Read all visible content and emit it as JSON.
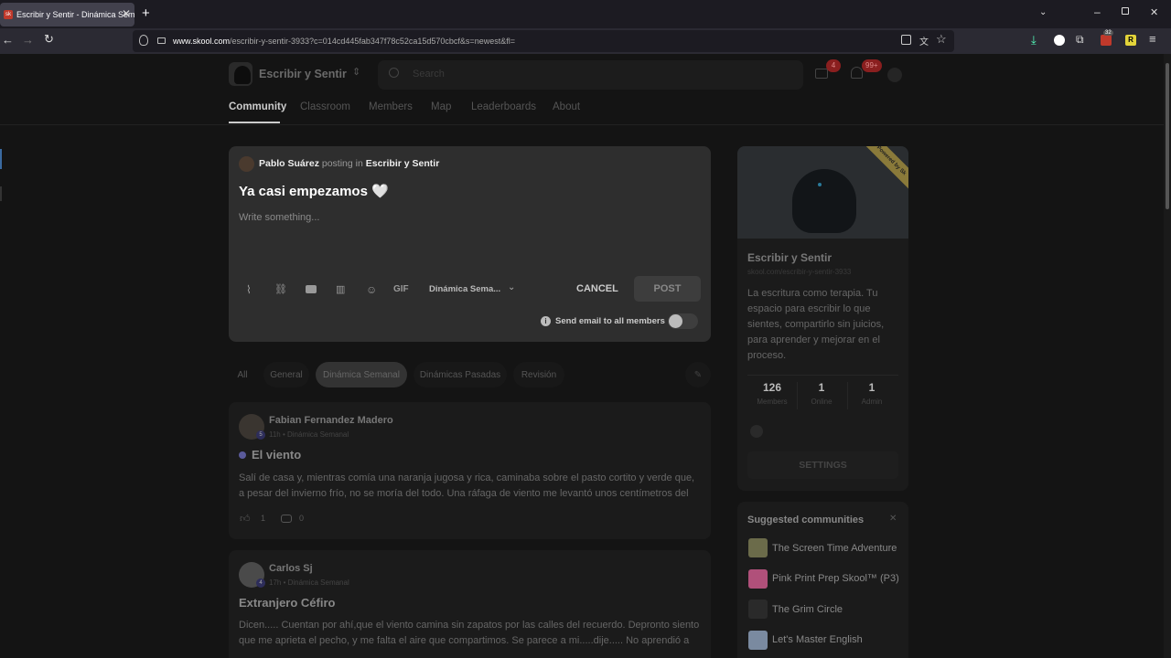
{
  "browser": {
    "tab_title": "Escribir y Sentir - Dinámica Semanal",
    "favicon_text": "sk",
    "url_domain": "www.skool.com",
    "url_path": "/escribir-y-sentir-3933?c=014cd445fab347f78c52ca15d570cbcf&s=newest&fl=",
    "ext_badge": "32"
  },
  "header": {
    "community_name": "Escribir y Sentir",
    "search_placeholder": "Search",
    "chat_badge": "4",
    "notif_badge": "99+"
  },
  "nav": [
    "Community",
    "Classroom",
    "Members",
    "Map",
    "Leaderboards",
    "About"
  ],
  "composer": {
    "author": "Pablo Suárez",
    "posting_in": "posting in",
    "group": "Escribir y Sentir",
    "title": "Ya casi empezamos 🤍",
    "body_placeholder": "Write something...",
    "gif_label": "GIF",
    "category": "Dinámica Sema...",
    "cancel": "CANCEL",
    "post": "POST",
    "email_label": "Send email to all members"
  },
  "filters": [
    "All",
    "General",
    "Dinámica Semanal",
    "Dinámicas Pasadas",
    "Revisión"
  ],
  "posts": [
    {
      "author": "Fabian Fernandez Madero",
      "level": "5",
      "meta": "11h • Dinámica Semanal",
      "title": "El viento",
      "body": "Salí de casa y, mientras comía una naranja jugosa y rica, caminaba sobre el pasto cortito y verde que, a pesar del invierno frío, no se moría del todo. Una ráfaga de viento me levantó unos centímetros del",
      "likes": "1",
      "comments": "0"
    },
    {
      "author": "Carlos Sj",
      "level": "4",
      "meta": "17h • Dinámica Semanal",
      "title": "Extranjero Céfiro",
      "body": "Dicen..... Cuentan por ahí,que el viento camina sin zapatos por las calles del recuerdo. Depronto siento que me aprieta el pecho, y me falta el aire que compartimos. Se parece a mi.....dije..... No aprendió a"
    }
  ],
  "sidebar": {
    "ribbon": "Powered by Sk",
    "name": "Escribir y Sentir",
    "url": "skool.com/escribir-y-sentir-3933",
    "description": "La escritura como terapia. Tu espacio para escribir lo que sientes, compartirlo sin juicios, para aprender y mejorar en el proceso.",
    "stats": [
      {
        "num": "126",
        "label": "Members"
      },
      {
        "num": "1",
        "label": "Online"
      },
      {
        "num": "1",
        "label": "Admin"
      }
    ],
    "settings": "SETTINGS"
  },
  "suggested": {
    "title": "Suggested communities",
    "items": [
      {
        "name": "The Screen Time Adventure",
        "color": "#6b6b4a"
      },
      {
        "name": "Pink Print Prep Skool™ (P3)",
        "color": "#b0507a"
      },
      {
        "name": "The Grim Circle",
        "color": "#2a2a2a"
      },
      {
        "name": "Let's Master English",
        "color": "#7a8aa0"
      }
    ]
  }
}
